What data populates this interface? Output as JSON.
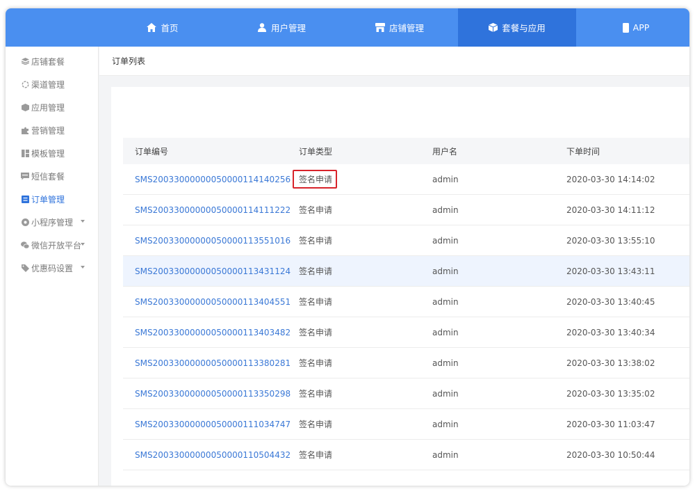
{
  "topnav": {
    "items": [
      {
        "label": "首页",
        "icon": "home-icon"
      },
      {
        "label": "用户管理",
        "icon": "users-icon"
      },
      {
        "label": "店铺管理",
        "icon": "store-icon"
      },
      {
        "label": "套餐与应用",
        "icon": "cube-icon",
        "active": true
      },
      {
        "label": "APP",
        "icon": "phone-icon"
      }
    ],
    "active_color": "#2f73dc",
    "bar_color": "#4a8ff0"
  },
  "sidebar": {
    "items": [
      {
        "label": "店铺套餐",
        "icon": "layers-icon"
      },
      {
        "label": "渠道管理",
        "icon": "channel-icon"
      },
      {
        "label": "应用管理",
        "icon": "box-icon"
      },
      {
        "label": "营销管理",
        "icon": "puzzle-icon"
      },
      {
        "label": "模板管理",
        "icon": "template-icon"
      },
      {
        "label": "短信套餐",
        "icon": "message-icon"
      },
      {
        "label": "订单管理",
        "icon": "order-icon",
        "active": true
      },
      {
        "label": "小程序管理",
        "icon": "miniapp-icon",
        "expandable": true
      },
      {
        "label": "微信开放平台",
        "icon": "wechat-icon",
        "expandable": true
      },
      {
        "label": "优惠码设置",
        "icon": "tag-icon",
        "expandable": true
      }
    ]
  },
  "breadcrumb": "订单列表",
  "table": {
    "headers": [
      "订单编号",
      "订单类型",
      "用户名",
      "下单时间"
    ],
    "rows": [
      {
        "order": "SMS20033000000050000114140256",
        "type": "签名申请",
        "user": "admin",
        "time": "2020-03-30 14:14:02"
      },
      {
        "order": "SMS20033000000050000114111222",
        "type": "签名申请",
        "user": "admin",
        "time": "2020-03-30 14:11:12"
      },
      {
        "order": "SMS20033000000050000113551016",
        "type": "签名申请",
        "user": "admin",
        "time": "2020-03-30 13:55:10"
      },
      {
        "order": "SMS20033000000050000113431124",
        "type": "签名申请",
        "user": "admin",
        "time": "2020-03-30 13:43:11"
      },
      {
        "order": "SMS20033000000050000113404551",
        "type": "签名申请",
        "user": "admin",
        "time": "2020-03-30 13:40:45"
      },
      {
        "order": "SMS20033000000050000113403482",
        "type": "签名申请",
        "user": "admin",
        "time": "2020-03-30 13:40:34"
      },
      {
        "order": "SMS20033000000050000113380281",
        "type": "签名申请",
        "user": "admin",
        "time": "2020-03-30 13:38:02"
      },
      {
        "order": "SMS20033000000050000113350298",
        "type": "签名申请",
        "user": "admin",
        "time": "2020-03-30 13:35:02"
      },
      {
        "order": "SMS20033000000050000111034747",
        "type": "签名申请",
        "user": "admin",
        "time": "2020-03-30 11:03:47"
      },
      {
        "order": "SMS20033000000050000110504432",
        "type": "签名申请",
        "user": "admin",
        "time": "2020-03-30 10:50:44"
      }
    ],
    "highlight_color": "#d8232a"
  }
}
